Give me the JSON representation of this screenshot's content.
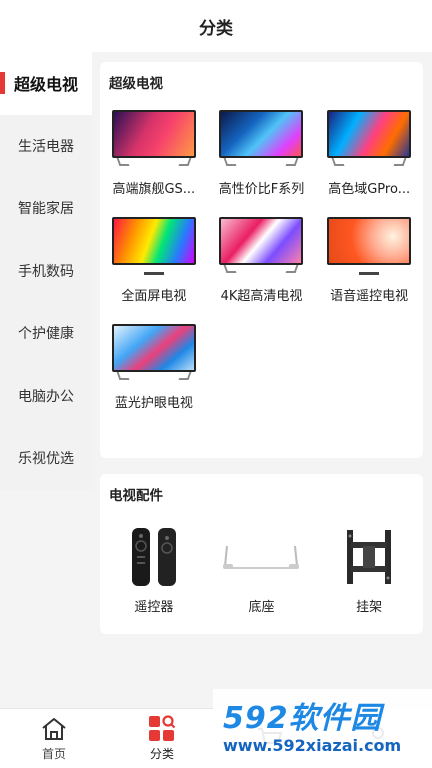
{
  "header": {
    "title": "分类"
  },
  "sidebar": {
    "items": [
      {
        "label": "超级电视",
        "active": true
      },
      {
        "label": "生活电器",
        "active": false
      },
      {
        "label": "智能家居",
        "active": false
      },
      {
        "label": "手机数码",
        "active": false
      },
      {
        "label": "个护健康",
        "active": false
      },
      {
        "label": "电脑办公",
        "active": false
      },
      {
        "label": "乐视优选",
        "active": false
      }
    ]
  },
  "section_tv": {
    "title": "超级电视",
    "products": [
      {
        "label": "高端旗舰GS...",
        "icon": "tv-icon"
      },
      {
        "label": "高性价比F系列",
        "icon": "tv-icon"
      },
      {
        "label": "高色域GPro...",
        "icon": "tv-icon"
      },
      {
        "label": "全面屏电视",
        "icon": "tv-icon"
      },
      {
        "label": "4K超高清电视",
        "icon": "tv-icon"
      },
      {
        "label": "语音遥控电视",
        "icon": "tv-icon"
      },
      {
        "label": "蓝光护眼电视",
        "icon": "tv-icon"
      }
    ]
  },
  "section_accessories": {
    "title": "电视配件",
    "items": [
      {
        "label": "遥控器",
        "icon": "remote-control-icon"
      },
      {
        "label": "底座",
        "icon": "tv-base-icon"
      },
      {
        "label": "挂架",
        "icon": "wall-mount-icon"
      }
    ]
  },
  "tabbar": {
    "tabs": [
      {
        "label": "首页",
        "icon": "home-icon",
        "active": false
      },
      {
        "label": "分类",
        "icon": "category-icon",
        "active": true
      },
      {
        "label": "",
        "icon": "cart-icon",
        "active": false
      },
      {
        "label": "",
        "icon": "user-icon",
        "active": false
      }
    ]
  },
  "watermark": {
    "main": "592软件园",
    "url": "www.592xiazai.com"
  },
  "colors": {
    "accent": "#e53935",
    "watermark_blue": "#1e88e5"
  }
}
